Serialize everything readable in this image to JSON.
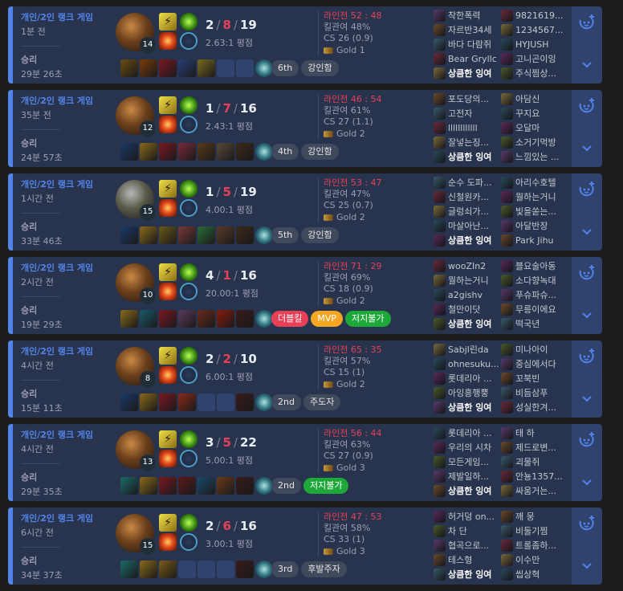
{
  "matches": [
    {
      "queue": "개인/2인 랭크 게임",
      "ago": "1분 전",
      "result": "승리",
      "duration": "29분 26초",
      "level": "14",
      "k": "2",
      "d": "8",
      "a": "19",
      "ratio": "2.63:1 평점",
      "lane": "라인전 52 : 48",
      "kp": "킬관여 48%",
      "cs": "CS 26 (0.9)",
      "tier": "Gold 1",
      "items": [
        "#6b4b12",
        "#7a3b0a",
        "#7a1a22",
        "#2a3f7a",
        "#7a6a20",
        "#2f436e",
        "#2f436e"
      ],
      "badges": [
        {
          "label": "6th",
          "style": ""
        },
        {
          "label": "강인함",
          "style": ""
        }
      ],
      "blue": [
        "착한폭력",
        "자르반34세",
        "바다 다람쥐",
        "Bear Gryllc",
        "상큼한 잉여"
      ],
      "red": [
        "9821619...",
        "1234567...",
        "HYJUSH",
        "고니곤이잉",
        "주식찜상..."
      ],
      "ward": "v"
    },
    {
      "queue": "개인/2인 랭크 게임",
      "ago": "35분 전",
      "result": "승리",
      "duration": "24분 57초",
      "level": "12",
      "k": "1",
      "d": "7",
      "a": "16",
      "ratio": "2.43:1 평점",
      "lane": "라인전 46 : 54",
      "kp": "킬관여 61%",
      "cs": "CS 27 (1.1)",
      "tier": "Gold 2",
      "items": [
        "#1a3a6a",
        "#8a6a1a",
        "#7a1a22",
        "#7a2a3a",
        "#5a3a1a",
        "#5a4a3a",
        "#3a2a1a"
      ],
      "badges": [
        {
          "label": "4th",
          "style": ""
        },
        {
          "label": "강인함",
          "style": ""
        }
      ],
      "blue": [
        "포도당의...",
        "고전자",
        "llllllllllll",
        "잘넣는징...",
        "상큼한 잉여"
      ],
      "red": [
        "아담신",
        "꾸지요",
        "오달마",
        "소거기먹방",
        "느낌있는 ..."
      ],
      "ward": "v"
    },
    {
      "queue": "개인/2인 랭크 게임",
      "ago": "1시간 전",
      "result": "승리",
      "duration": "33분 46초",
      "level": "15",
      "k": "1",
      "d": "5",
      "a": "19",
      "ratio": "4.00:1 평점",
      "lane": "라인전 53 : 47",
      "kp": "킬관여 47%",
      "cs": "CS 25 (0.7)",
      "tier": "Gold 2",
      "items": [
        "#1a3a6a",
        "#8a6a1a",
        "#6a5a1a",
        "#7a3a3a",
        "#2a6a3a",
        "#5a3a2a",
        "#3a2a1a"
      ],
      "badges": [
        {
          "label": "5th",
          "style": ""
        },
        {
          "label": "강인함",
          "style": ""
        }
      ],
      "blue": [
        "순수 도파...",
        "신철원카...",
        "글렁쇠가...",
        "마살아난...",
        "상큼한 잉여"
      ],
      "red": [
        "아리수호텔",
        "뭘하는거니",
        "빛을쏟는...",
        "아달반장",
        "Park Jihu"
      ],
      "ward": "v",
      "alt": true
    },
    {
      "queue": "개인/2인 랭크 게임",
      "ago": "2시간 전",
      "result": "승리",
      "duration": "19분 29초",
      "level": "10",
      "k": "4",
      "d": "1",
      "a": "16",
      "ratio": "20.00:1 평점",
      "lane": "라인전 71 : 29",
      "kp": "킬관여 69%",
      "cs": "CS 18 (0.9)",
      "tier": "Gold 2",
      "items": [
        "#8a6a1a",
        "#1a5a6a",
        "#7a1a22",
        "#5a3a5a",
        "#6a2a1a",
        "#8a1a0a",
        "#3a1a1a"
      ],
      "badges": [
        {
          "label": "더블킬",
          "style": "red"
        },
        {
          "label": "MVP",
          "style": "mvp"
        },
        {
          "label": "저지불가",
          "style": "green"
        }
      ],
      "blue": [
        "wooZIn2",
        "뭘하는거니",
        "a2gishv",
        "철만이닷",
        "상큼한 잉여"
      ],
      "red": [
        "블요술아동",
        "소다향녹대",
        "푸슈파슈...",
        "무릉이에요",
        "떡국년"
      ],
      "ward": "v"
    },
    {
      "queue": "개인/2인 랭크 게임",
      "ago": "4시간 전",
      "result": "승리",
      "duration": "15분 11초",
      "level": "8",
      "k": "2",
      "d": "2",
      "a": "10",
      "ratio": "6.00:1 평점",
      "lane": "라인전 65 : 35",
      "kp": "킬관여 57%",
      "cs": "CS 15 (1)",
      "tier": "Gold 2",
      "items": [
        "#1a3a6a",
        "#8a6a1a",
        "#7a1a22",
        "#8a2a1a",
        "#2f436e",
        "#2f436e",
        "#3a1a1a"
      ],
      "badges": [
        {
          "label": "2nd",
          "style": ""
        },
        {
          "label": "주도자",
          "style": ""
        }
      ],
      "blue": [
        "Sabjl린da",
        "ohnesuku...",
        "롯데리아 ...",
        "아잉흥행뿡",
        "상큼한 잉여"
      ],
      "red": [
        "미나아이",
        "중심에서다",
        "꼬북빈",
        "비듬삼푸",
        "성실한겨..."
      ],
      "ward": "v"
    },
    {
      "queue": "개인/2인 랭크 게임",
      "ago": "4시간 전",
      "result": "승리",
      "duration": "29분 35초",
      "level": "13",
      "k": "3",
      "d": "5",
      "a": "22",
      "ratio": "5.00:1 평점",
      "lane": "라인전 56 : 44",
      "kp": "킬관여 63%",
      "cs": "CS 27 (0.9)",
      "tier": "Gold 3",
      "items": [
        "#1a6a6a",
        "#8a6a1a",
        "#7a1a22",
        "#5a1a1a",
        "#1a4a6a",
        "#6a3a1a",
        "#3a1a1a"
      ],
      "badges": [
        {
          "label": "2nd",
          "style": ""
        },
        {
          "label": "저지불가",
          "style": "green"
        }
      ],
      "blue": [
        "롯데리아 ...",
        "우리의 시차",
        "모든게임...",
        "제발일하...",
        "상큼한 잉여"
      ],
      "red": [
        "태 하",
        "제드로변...",
        "괴물쥐",
        "안뇽1357...",
        "싸움거는..."
      ],
      "ward": "v"
    },
    {
      "queue": "개인/2인 랭크 게임",
      "ago": "6시간 전",
      "result": "승리",
      "duration": "34분 37초",
      "level": "15",
      "k": "2",
      "d": "6",
      "a": "16",
      "ratio": "3.00:1 평점",
      "lane": "라인전 47 : 53",
      "kp": "킬관여 58%",
      "cs": "CS 33 (1)",
      "tier": "Gold 3",
      "items": [
        "#1a6a6a",
        "#8a6a1a",
        "#7a5a1a",
        "#2f436e",
        "#2f436e",
        "#2f436e",
        "#3a1a1a"
      ],
      "badges": [
        {
          "label": "3rd",
          "style": ""
        },
        {
          "label": "후발주자",
          "style": ""
        }
      ],
      "blue": [
        "허거덩 on...",
        "차 단",
        "협곡으로...",
        "테스형",
        "상큼한 잉여"
      ],
      "red": [
        "깨 뭉",
        "비둘기찜",
        "트롤좀하...",
        "이수만",
        "씹상혁"
      ],
      "ward": "v"
    }
  ],
  "colors": {
    "accent": "#5383e8",
    "death": "#e84057",
    "card": "#28344e"
  }
}
